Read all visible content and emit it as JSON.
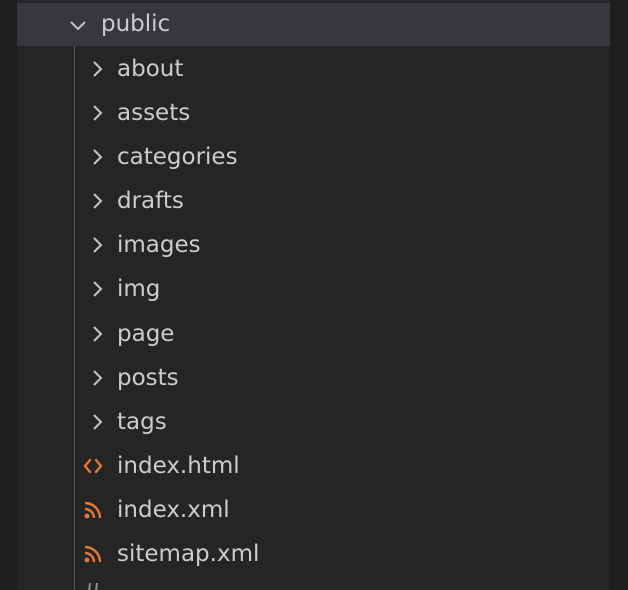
{
  "explorer": {
    "root": {
      "label": "public",
      "expanded": true,
      "icon": "chevron-down-icon"
    },
    "folders": [
      {
        "label": "about",
        "icon": "chevron-right-icon"
      },
      {
        "label": "assets",
        "icon": "chevron-right-icon"
      },
      {
        "label": "categories",
        "icon": "chevron-right-icon"
      },
      {
        "label": "drafts",
        "icon": "chevron-right-icon"
      },
      {
        "label": "images",
        "icon": "chevron-right-icon"
      },
      {
        "label": "img",
        "icon": "chevron-right-icon"
      },
      {
        "label": "page",
        "icon": "chevron-right-icon"
      },
      {
        "label": "posts",
        "icon": "chevron-right-icon"
      },
      {
        "label": "tags",
        "icon": "chevron-right-icon"
      }
    ],
    "files": [
      {
        "label": "index.html",
        "icon": "html-code-icon"
      },
      {
        "label": "index.xml",
        "icon": "rss-feed-icon"
      },
      {
        "label": "sitemap.xml",
        "icon": "rss-feed-icon"
      }
    ]
  },
  "colors": {
    "background": "#252526",
    "selected_row": "#37373d",
    "text": "#cccccc",
    "file_icon_orange": "#e37933"
  }
}
